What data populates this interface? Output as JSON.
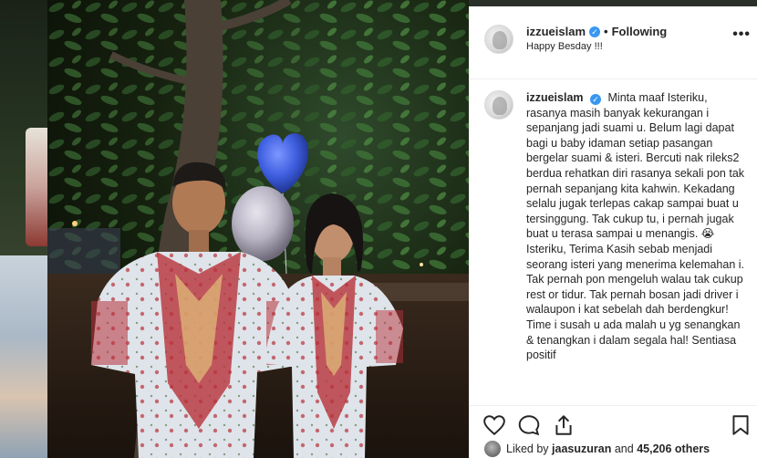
{
  "post": {
    "username": "izzueislam",
    "follow_state": "Following",
    "location": "Happy Besday !!!",
    "more": "•••",
    "verified_glyph": "✓",
    "separator": "•"
  },
  "caption": {
    "username": "izzueislam",
    "text": "Minta maaf Isteriku, rasanya masih banyak kekurangan i sepanjang jadi suami u. Belum lagi dapat bagi u baby idaman setiap pasangan bergelar suami & isteri. Bercuti nak rileks2 berdua rehatkan diri rasanya sekali pon tak pernah sepanjang kita kahwin. Kekadang selalu jugak terlepas cakap sampai buat u tersinggung. Tak cukup tu, i pernah jugak buat u terasa sampai u menangis. 😭 Isteriku, Terima Kasih sebab menjadi seorang isteri yang menerima kelemahan i. Tak pernah pon mengeluh walau tak cukup rest or tidur. Tak pernah bosan jadi driver i walaupon i kat sebelah dah berdengkur! Time i susah u ada malah u yg senangkan & tenangkan i dalam segala hal! Sentiasa positif"
  },
  "actions": {
    "like": "heart-icon",
    "comment": "comment-icon",
    "share": "share-icon",
    "save": "bookmark-icon"
  },
  "likes": {
    "prefix": "Liked by",
    "user": "jaasuzuran",
    "conjunction": "and",
    "count": "45,206 others"
  },
  "colors": {
    "verified": "#3897f0",
    "text": "#262626",
    "border": "#efefef",
    "balloon_blue": "#3f5fe0",
    "balloon_silver": "#b9b4c4",
    "shirt_red": "#b8323a"
  }
}
